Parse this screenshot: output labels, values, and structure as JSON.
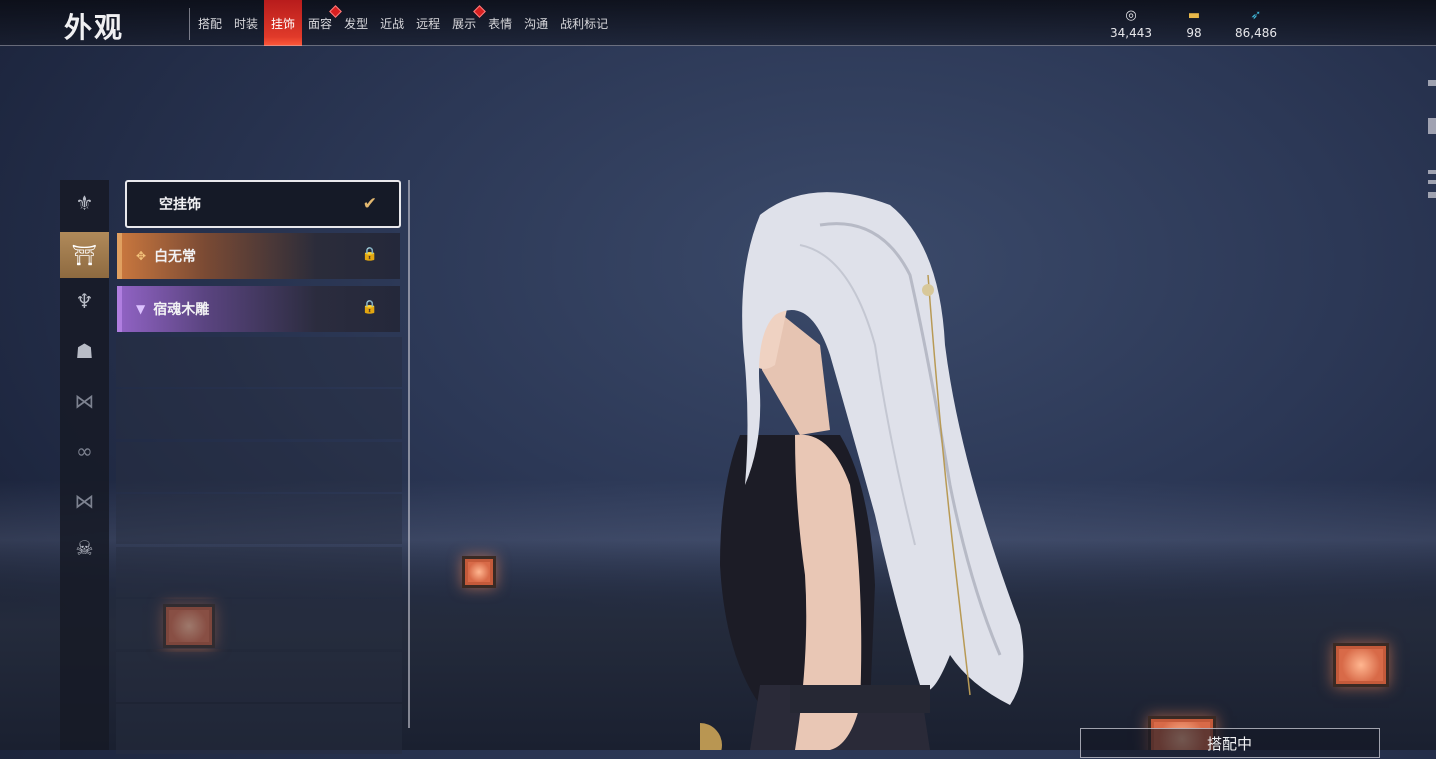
{
  "header": {
    "title": "外观",
    "tabs": [
      {
        "label": "搭配",
        "active": false,
        "badge": false
      },
      {
        "label": "时装",
        "active": false,
        "badge": false
      },
      {
        "label": "挂饰",
        "active": true,
        "badge": false
      },
      {
        "label": "面容",
        "active": false,
        "badge": true
      },
      {
        "label": "发型",
        "active": false,
        "badge": false
      },
      {
        "label": "近战",
        "active": false,
        "badge": false
      },
      {
        "label": "远程",
        "active": false,
        "badge": false
      },
      {
        "label": "展示",
        "active": false,
        "badge": true
      },
      {
        "label": "表情",
        "active": false,
        "badge": false
      },
      {
        "label": "沟通",
        "active": false,
        "badge": false
      },
      {
        "label": "战利标记",
        "active": false,
        "badge": false
      }
    ],
    "currencies": [
      {
        "icon": "coin-swirl-icon",
        "value": "34,443"
      },
      {
        "icon": "treasure-box-icon",
        "value": "98"
      },
      {
        "icon": "feather-icon",
        "value": "86,486"
      }
    ]
  },
  "categories": [
    {
      "icon": "helmet-icon",
      "active": false
    },
    {
      "icon": "hat-lantern-icon",
      "active": true
    },
    {
      "icon": "hairpin-icon",
      "active": false
    },
    {
      "icon": "cape-icon",
      "active": false
    },
    {
      "icon": "bow-icon",
      "active": false
    },
    {
      "icon": "mask-band-icon",
      "active": false
    },
    {
      "icon": "ribbon-icon",
      "active": false
    },
    {
      "icon": "demon-mask-icon",
      "active": false
    }
  ],
  "items": [
    {
      "name": "空挂饰",
      "state": "selected",
      "quality": "none",
      "locked": false
    },
    {
      "name": "白无常",
      "state": "normal",
      "quality": "orange",
      "locked": true
    },
    {
      "name": "宿魂木雕",
      "state": "normal",
      "quality": "purple",
      "locked": true
    }
  ],
  "equip_button": {
    "label": "搭配中"
  },
  "colors": {
    "accent_red": "#e03a2a",
    "quality_orange": "#c7763e",
    "quality_purple": "#8f62c2",
    "check_gold": "#e2b870"
  }
}
